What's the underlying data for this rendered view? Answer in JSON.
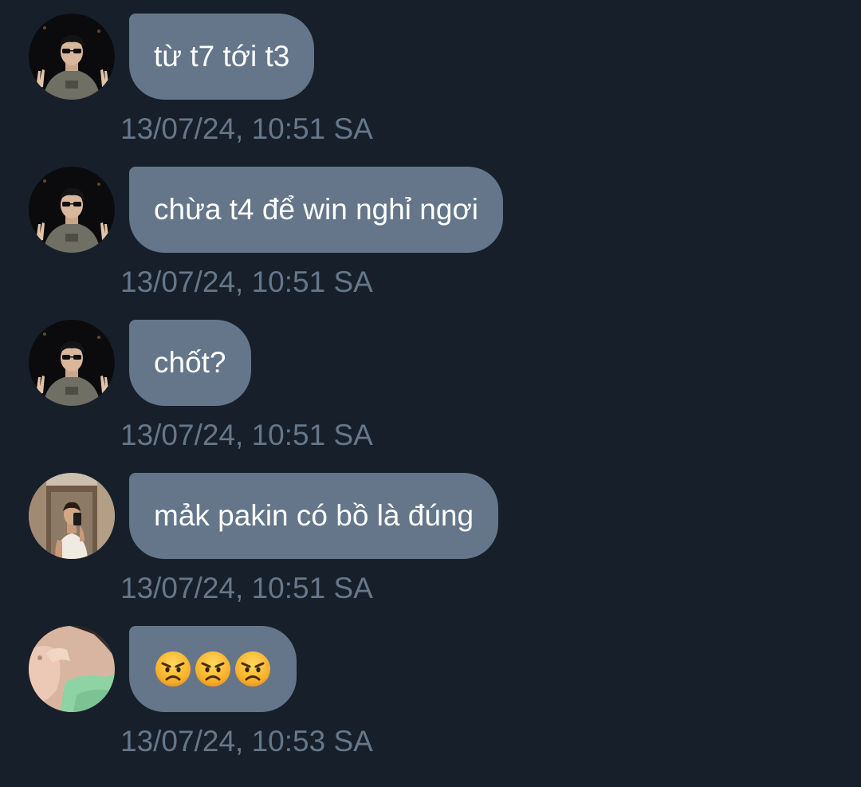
{
  "messages": [
    {
      "avatar": "avatar-man-peace-sign",
      "text": "từ t7 tới t3",
      "time": "13/07/24, 10:51 SA"
    },
    {
      "avatar": "avatar-man-peace-sign",
      "text": "chừa t4 để win nghỉ ngơi",
      "time": "13/07/24, 10:51 SA"
    },
    {
      "avatar": "avatar-man-peace-sign",
      "text": "chốt?",
      "time": "13/07/24, 10:51 SA"
    },
    {
      "avatar": "avatar-man-mirror-selfie",
      "text": "mảk pakin có bồ là đúng",
      "time": "13/07/24, 10:51 SA"
    },
    {
      "avatar": "avatar-hand-green-shirt",
      "emojis": [
        "angry-face-emoji",
        "angry-face-emoji",
        "angry-face-emoji"
      ],
      "time": "13/07/24, 10:53 SA"
    }
  ],
  "colors": {
    "background": "#17202a",
    "bubble": "#65768a",
    "timestamp": "#66778a",
    "text": "#ffffff"
  }
}
